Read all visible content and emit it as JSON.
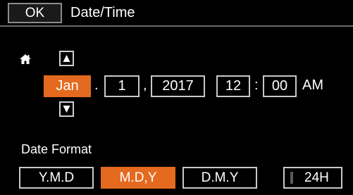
{
  "header": {
    "ok_label": "OK",
    "title": "Date/Time"
  },
  "date_time": {
    "month": "Jan",
    "day": "1",
    "year": "2017",
    "hour": "12",
    "minute": "00",
    "ampm": "AM",
    "sep_month_day": ".",
    "sep_day_year": ",",
    "sep_hour_minute": ":",
    "selected_field": "month"
  },
  "date_format": {
    "label": "Date Format",
    "options": [
      "Y.M.D",
      "M.D,Y",
      "D.M.Y"
    ],
    "selected": "M.D,Y",
    "toggle_24h_label": "24H",
    "toggle_24h_on": false
  },
  "icons": {
    "home": "home-icon",
    "up": "up-arrow-icon",
    "down": "down-arrow-icon"
  },
  "colors": {
    "accent": "#e46a1f",
    "background": "#000000",
    "border": "#c8c8c8",
    "text": "#ffffff",
    "toggle_off_indicator": "#5a5a5a"
  }
}
